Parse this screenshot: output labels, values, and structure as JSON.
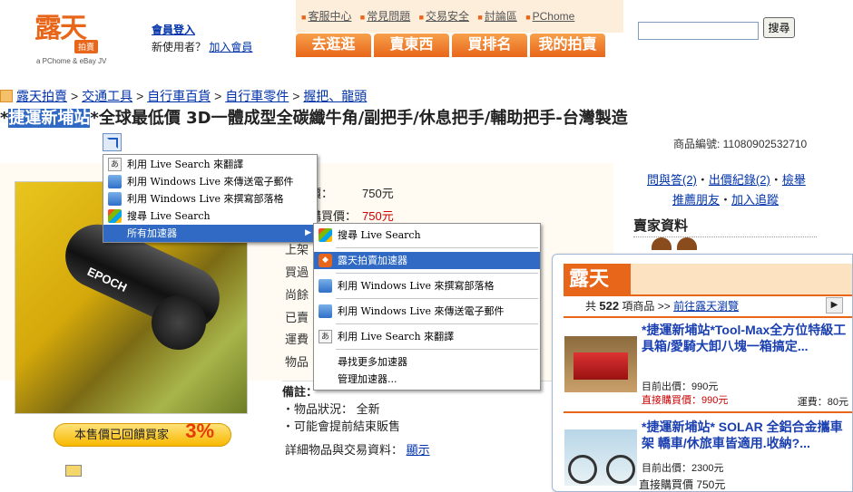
{
  "header": {
    "logo_main": "露天",
    "logo_badge": "拍賣",
    "logo_sub": "a PChome & eBay JV",
    "login": "會員登入",
    "new_user": "新使用者？",
    "join": "加入會員",
    "top_links": [
      "客服中心",
      "常見問題",
      "交易安全",
      "討論區",
      "PChome"
    ],
    "nav_tabs": [
      "去逛逛",
      "賣東西",
      "買排名",
      "我的拍賣"
    ],
    "search_value": "",
    "search_button": "搜尋"
  },
  "breadcrumb": [
    "露天拍賣",
    "交通工具",
    "自行車百貨",
    "自行車零件",
    "握把、龍頭"
  ],
  "title": {
    "prefix": "*",
    "highlight": "捷運新埔站",
    "rest": "*全球最低價 3D一體成型全碳纖牛角/副把手/休息把手/輔助把手-台灣製造"
  },
  "item_no": "商品編號: 11080902532710",
  "prices": {
    "start_label": "價：",
    "start_value": "750元",
    "direct_label": "購買價：",
    "direct_value": "750元"
  },
  "cut_labels": [
    "上架",
    "買過",
    "尚餘",
    "已賣",
    "運費",
    "物品"
  ],
  "notes": {
    "header": "備註：",
    "lines": [
      "・物品狀況： 全新",
      "・可能會提前結束販售"
    ]
  },
  "detail": {
    "label": "詳細物品與交易資料：",
    "link": "顯示"
  },
  "right": {
    "links_row1": [
      "問與答(2)",
      "出價紀錄(2)",
      "檢舉"
    ],
    "links_row2": [
      "推薦朋友",
      "加入追蹤"
    ],
    "seller_title": "賣家資料"
  },
  "reward": {
    "label": "本售價已回饋買家",
    "pct": "3%"
  },
  "photo_text": "EPOCH",
  "context_menu": {
    "items": [
      {
        "label": "利用 Live Search 來翻譯",
        "icon": "translate-icon"
      },
      {
        "label": "利用 Windows Live 來傳送電子郵件",
        "icon": "windows-live-icon"
      },
      {
        "label": "利用 Windows Live 來撰寫部落格",
        "icon": "windows-live-icon"
      },
      {
        "label": "搜尋 Live Search",
        "icon": "windows-search-icon"
      },
      {
        "label": "所有加速器",
        "icon": "",
        "selected": true,
        "submenu": true
      }
    ]
  },
  "submenu": {
    "items": [
      {
        "label": "搜尋 Live Search",
        "icon": "windows-search-icon"
      },
      {
        "label": "露天拍賣加速器",
        "icon": "accelerator-icon",
        "selected": true
      },
      {
        "label": "利用 Windows Live 來撰寫部落格",
        "icon": "windows-live-icon"
      },
      {
        "label": "利用 Windows Live 來傳送電子郵件",
        "icon": "windows-live-icon"
      },
      {
        "label": "利用 Live Search 來翻譯",
        "icon": "translate-icon"
      }
    ],
    "extra": [
      "尋找更多加速器",
      "管理加速器..."
    ]
  },
  "preview": {
    "logo": "露天",
    "count_prefix": "共",
    "count": "522",
    "count_suffix": "項商品",
    "go_link": "前往露天瀏覽",
    "next_button": "▶",
    "items": [
      {
        "title": "*捷運新埔站*Tool-Max全方位特級工具箱/愛騎大卸八塊一箱搞定...",
        "current_price": "目前出價：990元",
        "direct_price": "直接購買價：990元",
        "freight": "運費：80元"
      },
      {
        "title": "*捷運新埔站* SOLAR 全鋁合金攜車架 轎車/休旅車皆適用.收納?...",
        "current_price": "目前出價：2300元",
        "direct_price": "",
        "freight": ""
      }
    ],
    "last_line": "直接購買價 750元"
  }
}
